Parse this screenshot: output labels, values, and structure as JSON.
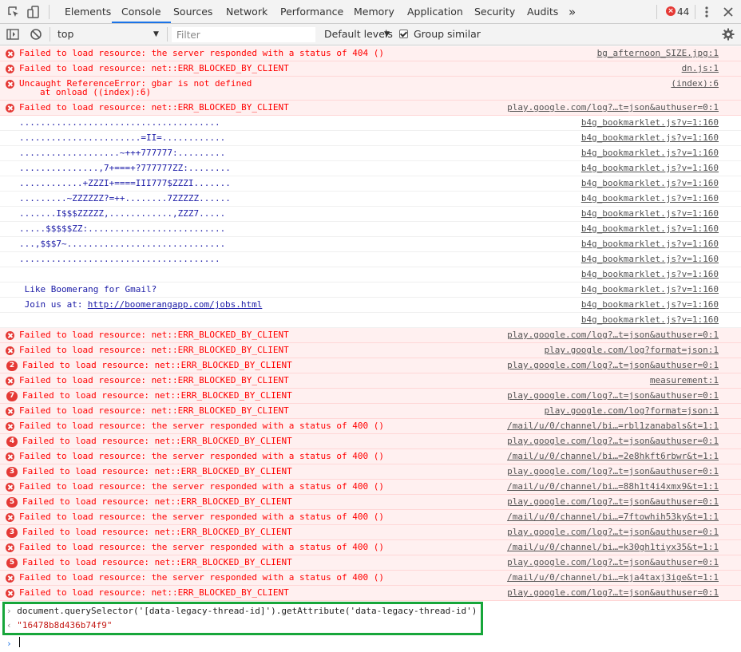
{
  "tabs": [
    "Elements",
    "Console",
    "Sources",
    "Network",
    "Performance",
    "Memory",
    "Application",
    "Security",
    "Audits"
  ],
  "more_tabs_icon": "chevron-double-right",
  "error_count": "44",
  "toolbar": {
    "context": "top",
    "filter_placeholder": "Filter",
    "levels": "Default levels",
    "group_similar": "Group similar"
  },
  "rows": [
    {
      "type": "error",
      "msg": "Failed to load resource: the server responded with a status of 404 ()",
      "src": "bg_afternoon_SIZE.jpg:1"
    },
    {
      "type": "error",
      "msg": "Failed to load resource: net::ERR_BLOCKED_BY_CLIENT",
      "src": "dn.js:1"
    },
    {
      "type": "error2",
      "msg": "Uncaught ReferenceError: gbar is not defined",
      "msg2": "at onload ((index):6)",
      "src": "(index):6"
    },
    {
      "type": "error",
      "msg": "Failed to load resource: net::ERR_BLOCKED_BY_CLIENT",
      "src": "play.google.com/log?…t=json&authuser=0:1"
    },
    {
      "type": "log",
      "msg": "......................................",
      "src": "b4g_bookmarklet.js?v=1:160"
    },
    {
      "type": "log",
      "msg": ".......................=II=............",
      "src": "b4g_bookmarklet.js?v=1:160"
    },
    {
      "type": "log",
      "msg": "...................~+++777777:.........",
      "src": "b4g_bookmarklet.js?v=1:160"
    },
    {
      "type": "log",
      "msg": "...............,7+===+?777777ZZ:........",
      "src": "b4g_bookmarklet.js?v=1:160"
    },
    {
      "type": "log",
      "msg": "............+ZZZI+====III777$ZZZI.......",
      "src": "b4g_bookmarklet.js?v=1:160"
    },
    {
      "type": "log",
      "msg": ".........~ZZZZZZ?=++........7ZZZZZ......",
      "src": "b4g_bookmarklet.js?v=1:160"
    },
    {
      "type": "log",
      "msg": ".......I$$$ZZZZZ,............,ZZZ7.....",
      "src": "b4g_bookmarklet.js?v=1:160"
    },
    {
      "type": "log",
      "msg": ".....$$$$$ZZ:..........................",
      "src": "b4g_bookmarklet.js?v=1:160"
    },
    {
      "type": "log",
      "msg": "...,$$$7~..............................",
      "src": "b4g_bookmarklet.js?v=1:160"
    },
    {
      "type": "log",
      "msg": "......................................",
      "src": "b4g_bookmarklet.js?v=1:160"
    },
    {
      "type": "log",
      "msg": "",
      "src": "b4g_bookmarklet.js?v=1:160"
    },
    {
      "type": "log",
      "msg": " Like Boomerang for Gmail?",
      "src": "b4g_bookmarklet.js?v=1:160"
    },
    {
      "type": "loglink",
      "msg": " Join us at: ",
      "link": "http://boomerangapp.com/jobs.html",
      "src": "b4g_bookmarklet.js?v=1:160"
    },
    {
      "type": "log",
      "msg": "",
      "src": "b4g_bookmarklet.js?v=1:160"
    },
    {
      "type": "error",
      "msg": "Failed to load resource: net::ERR_BLOCKED_BY_CLIENT",
      "src": "play.google.com/log?…t=json&authuser=0:1"
    },
    {
      "type": "error",
      "msg": "Failed to load resource: net::ERR_BLOCKED_BY_CLIENT",
      "src": "play.google.com/log?format=json:1"
    },
    {
      "type": "error",
      "count": "2",
      "msg": "Failed to load resource: net::ERR_BLOCKED_BY_CLIENT",
      "src": "play.google.com/log?…t=json&authuser=0:1"
    },
    {
      "type": "error",
      "msg": "Failed to load resource: net::ERR_BLOCKED_BY_CLIENT",
      "src": "measurement:1"
    },
    {
      "type": "error",
      "count": "7",
      "msg": "Failed to load resource: net::ERR_BLOCKED_BY_CLIENT",
      "src": "play.google.com/log?…t=json&authuser=0:1"
    },
    {
      "type": "error",
      "msg": "Failed to load resource: net::ERR_BLOCKED_BY_CLIENT",
      "src": "play.google.com/log?format=json:1"
    },
    {
      "type": "error",
      "msg": "Failed to load resource: the server responded with a status of 400 ()",
      "src": "/mail/u/0/channel/bi…=rbl1zanabals&t=1:1"
    },
    {
      "type": "error",
      "count": "4",
      "msg": "Failed to load resource: net::ERR_BLOCKED_BY_CLIENT",
      "src": "play.google.com/log?…t=json&authuser=0:1"
    },
    {
      "type": "error",
      "msg": "Failed to load resource: the server responded with a status of 400 ()",
      "src": "/mail/u/0/channel/bi…=2e8hkft6rbwr&t=1:1"
    },
    {
      "type": "error",
      "count": "3",
      "msg": "Failed to load resource: net::ERR_BLOCKED_BY_CLIENT",
      "src": "play.google.com/log?…t=json&authuser=0:1"
    },
    {
      "type": "error",
      "msg": "Failed to load resource: the server responded with a status of 400 ()",
      "src": "/mail/u/0/channel/bi…=88h1t4i4xmx9&t=1:1"
    },
    {
      "type": "error",
      "count": "5",
      "msg": "Failed to load resource: net::ERR_BLOCKED_BY_CLIENT",
      "src": "play.google.com/log?…t=json&authuser=0:1"
    },
    {
      "type": "error",
      "msg": "Failed to load resource: the server responded with a status of 400 ()",
      "src": "/mail/u/0/channel/bi…=7ftowhih53ky&t=1:1"
    },
    {
      "type": "error",
      "count": "3",
      "msg": "Failed to load resource: net::ERR_BLOCKED_BY_CLIENT",
      "src": "play.google.com/log?…t=json&authuser=0:1"
    },
    {
      "type": "error",
      "msg": "Failed to load resource: the server responded with a status of 400 ()",
      "src": "/mail/u/0/channel/bi…=k30gh1tiyx35&t=1:1"
    },
    {
      "type": "error",
      "count": "5",
      "msg": "Failed to load resource: net::ERR_BLOCKED_BY_CLIENT",
      "src": "play.google.com/log?…t=json&authuser=0:1"
    },
    {
      "type": "error",
      "msg": "Failed to load resource: the server responded with a status of 400 ()",
      "src": "/mail/u/0/channel/bi…=kja4taxj3ige&t=1:1"
    },
    {
      "type": "error",
      "msg": "Failed to load resource: net::ERR_BLOCKED_BY_CLIENT",
      "src": "play.google.com/log?…t=json&authuser=0:1"
    }
  ],
  "command": {
    "input": "document.querySelector('[data-legacy-thread-id]').getAttribute('data-legacy-thread-id')",
    "result": "\"16478b8d436b74f9\""
  },
  "colors": {
    "accent": "#1a73e8",
    "error_bg": "#fff0f0",
    "error_text": "#ff0000",
    "highlight": "#17a63a"
  }
}
